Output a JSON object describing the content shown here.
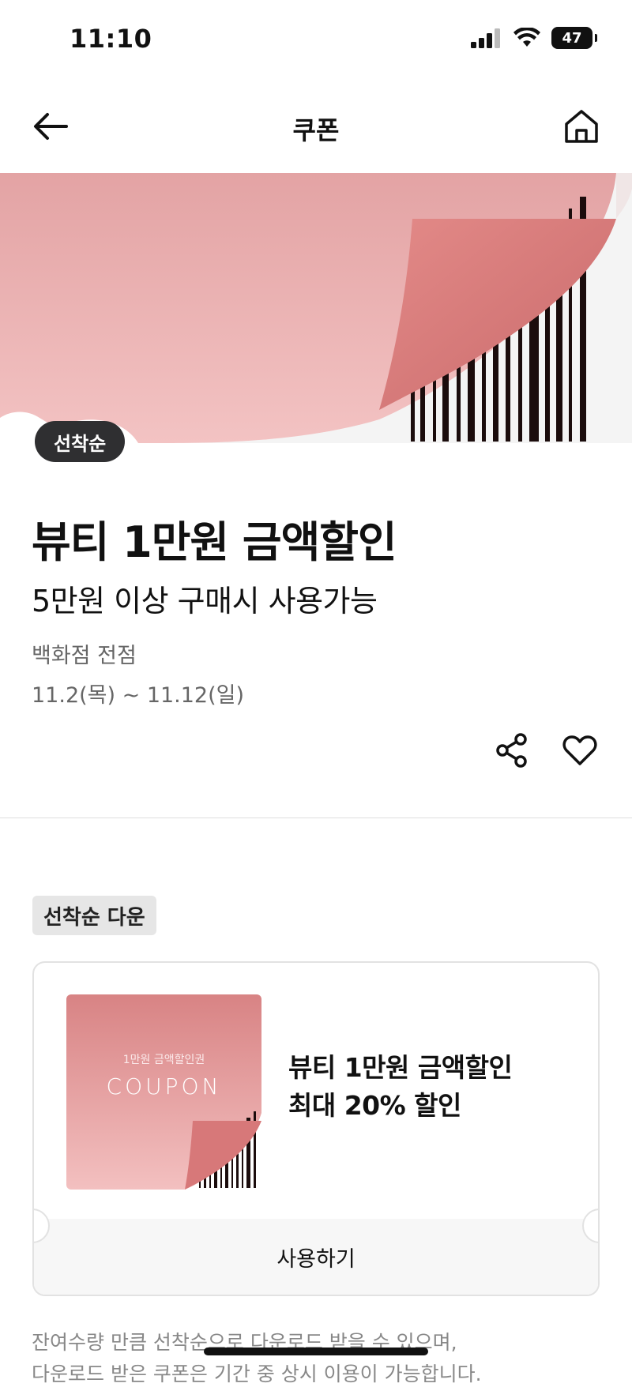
{
  "status_bar": {
    "time": "11:10",
    "battery": "47"
  },
  "nav": {
    "title": "쿠폰"
  },
  "hero": {
    "badge": "선착순"
  },
  "coupon": {
    "title": "뷰티 1만원 금액할인",
    "subtitle": "5만원 이상 구매시 사용가능",
    "store": "백화점 전점",
    "period": "11.2(목) ~ 11.12(일)"
  },
  "download": {
    "label": "선착순 다운",
    "card": {
      "thumb_small": "1만원 금액할인권",
      "thumb_word": "COUPON",
      "line1": "뷰티 1만원 금액할인",
      "line2": "최대 20% 할인",
      "use_button": "사용하기"
    }
  },
  "notice": {
    "line1": "잔여수량 만큼 선착순으로 다운로드 받을 수 있으며,",
    "line2": "다운로드 받은 쿠폰은 기간 중 상시 이용이 가능합니다."
  },
  "colors": {
    "accent_pink": "#d67a7a",
    "badge_dark": "#2f2f31"
  },
  "icons": [
    "back-arrow-icon",
    "home-icon",
    "share-icon",
    "heart-icon",
    "signal-icon",
    "wifi-icon",
    "battery-icon",
    "barcode-icon"
  ]
}
